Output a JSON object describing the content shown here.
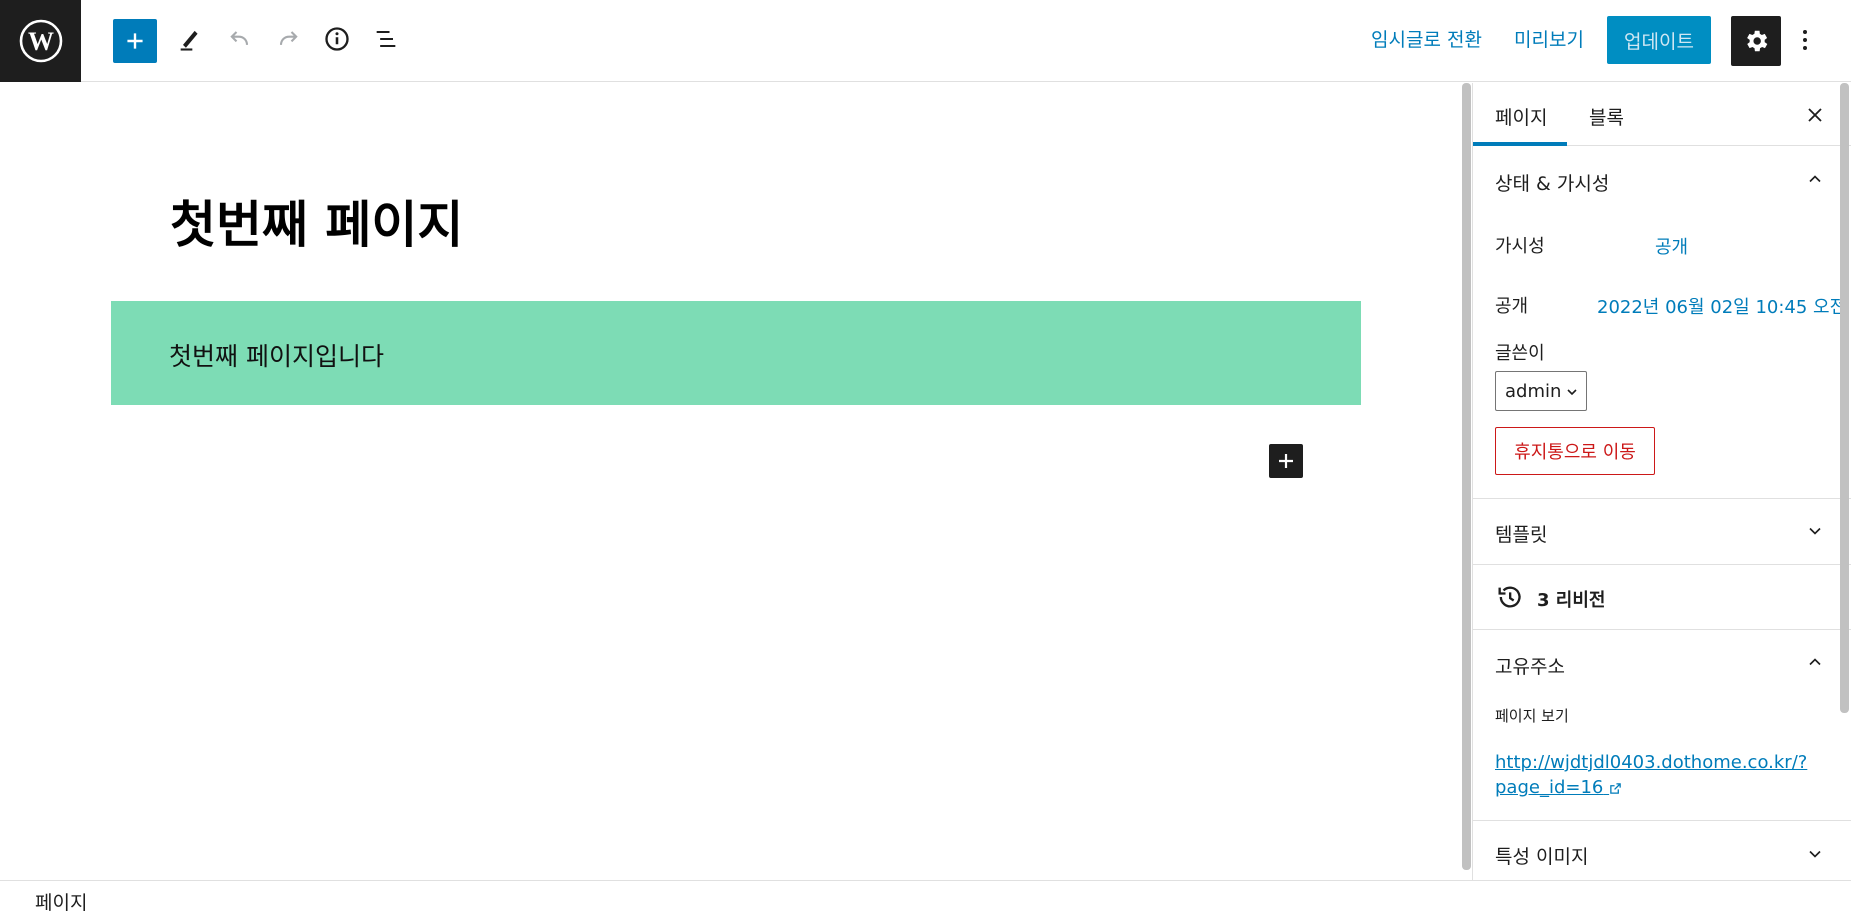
{
  "toolbar": {
    "draft_label": "임시글로 전환",
    "preview_label": "미리보기",
    "update_label": "업데이트"
  },
  "editor": {
    "title": "첫번째 페이지",
    "paragraph": "첫번째 페이지입니다",
    "block_color": "#7ddcb5"
  },
  "footer": {
    "breadcrumb": "페이지"
  },
  "sidebar": {
    "tabs": [
      {
        "label": "페이지",
        "active": true
      },
      {
        "label": "블록",
        "active": false
      }
    ],
    "status_panel": {
      "title": "상태 & 가시성",
      "visibility_label": "가시성",
      "visibility_value": "공개",
      "publish_label": "공개",
      "publish_value": "2022년 06월 02일 10:45 오전",
      "author_label": "글쓴이",
      "author_value": "admin",
      "trash_label": "휴지통으로 이동"
    },
    "template_panel": {
      "title": "템플릿"
    },
    "revisions": {
      "label": "3 리비전"
    },
    "permalink_panel": {
      "title": "고유주소",
      "view_label": "페이지 보기",
      "url_line1": "http://wjdtjdl0403.dothome.co.kr/?",
      "url_line2": "page_id=16"
    },
    "featured_image_panel": {
      "title": "특성 이미지"
    }
  },
  "colors": {
    "accent": "#007cba",
    "dark": "#1e1e1e",
    "danger": "#cc1818"
  }
}
